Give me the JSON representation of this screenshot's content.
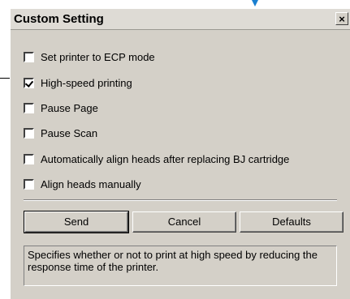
{
  "dialog": {
    "title": "Custom Setting",
    "close_glyph": "×"
  },
  "options": [
    {
      "label": "Set printer to ECP mode",
      "checked": false
    },
    {
      "label": "High-speed printing",
      "checked": true
    },
    {
      "label": "Pause Page",
      "checked": false
    },
    {
      "label": "Pause Scan",
      "checked": false
    },
    {
      "label": "Automatically align heads after replacing BJ cartridge",
      "checked": false
    },
    {
      "label": "Align heads manually",
      "checked": false
    }
  ],
  "buttons": {
    "send": "Send",
    "cancel": "Cancel",
    "defaults": "Defaults"
  },
  "description": "Specifies whether or not to print at high speed by reducing the response time of the printer.",
  "colors": {
    "dialog_bg": "#d4d0c8",
    "callout_arrow": "#1a7fd0"
  }
}
